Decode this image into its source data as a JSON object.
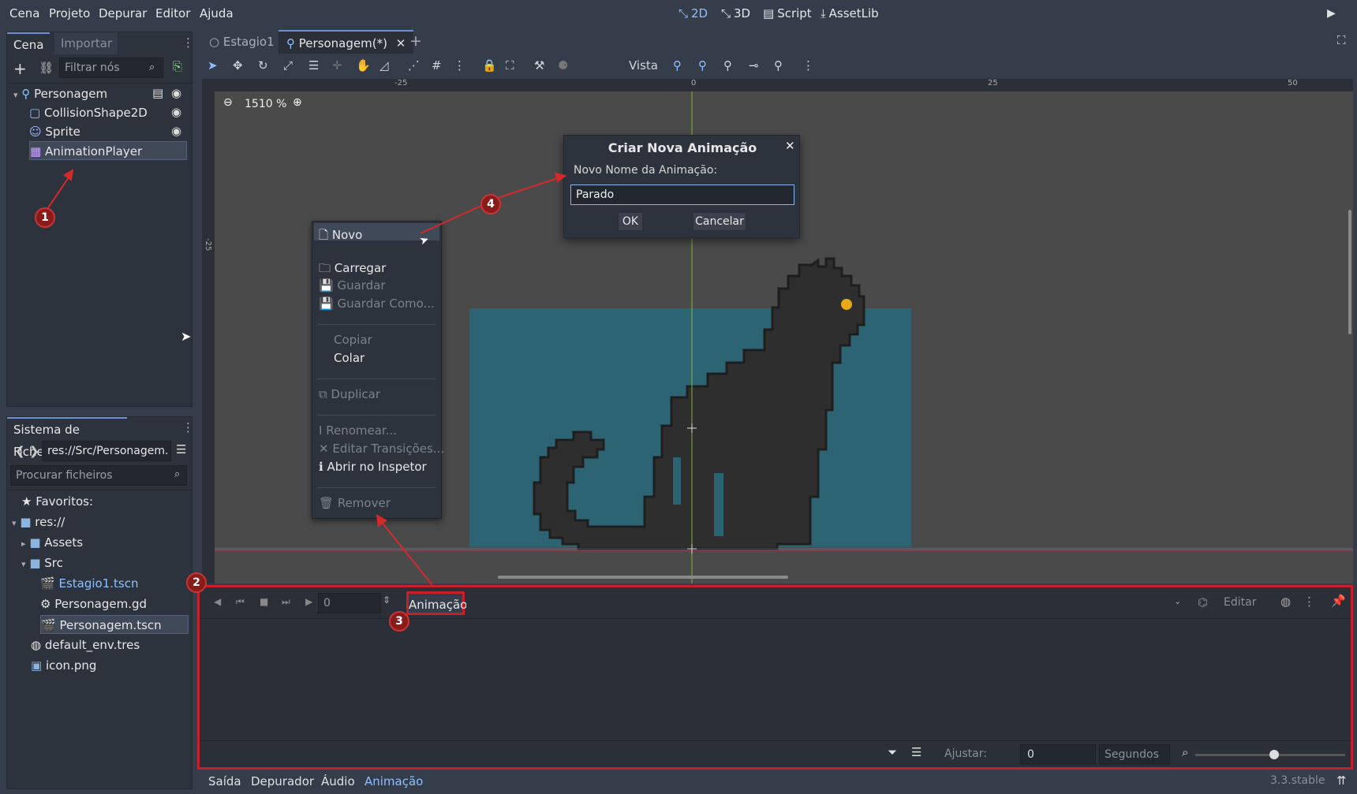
{
  "menubar": {
    "items": [
      "Cena",
      "Projeto",
      "Depurar",
      "Editor",
      "Ajuda"
    ],
    "workspaces": [
      "2D",
      "3D",
      "Script",
      "AssetLib"
    ],
    "active_workspace": "2D"
  },
  "scene_dock": {
    "tabs": [
      "Cena",
      "Importar"
    ],
    "filter_placeholder": "Filtrar nós",
    "nodes": [
      {
        "label": "Personagem",
        "icon": "kinematic-body-icon",
        "level": 0
      },
      {
        "label": "CollisionShape2D",
        "icon": "collision-shape-icon",
        "level": 1
      },
      {
        "label": "Sprite",
        "icon": "sprite-icon",
        "level": 1
      },
      {
        "label": "AnimationPlayer",
        "icon": "animation-player-icon",
        "level": 1,
        "selected": true
      }
    ]
  },
  "file_dock": {
    "title": "Sistema de Ficheiros",
    "path": "res://Src/Personagem.",
    "search_placeholder": "Procurar ficheiros",
    "items": [
      {
        "label": "Favoritos:",
        "icon": "star-icon",
        "level": 0
      },
      {
        "label": "res://",
        "icon": "folder-icon",
        "level": 0
      },
      {
        "label": "Assets",
        "icon": "folder-icon",
        "level": 1
      },
      {
        "label": "Src",
        "icon": "folder-icon",
        "level": 1
      },
      {
        "label": "Estagio1.tscn",
        "icon": "scene-icon",
        "level": 2,
        "color": "#8cc0ff"
      },
      {
        "label": "Personagem.gd",
        "icon": "gear-icon",
        "level": 2
      },
      {
        "label": "Personagem.tscn",
        "icon": "scene-icon",
        "level": 2,
        "selected": true
      },
      {
        "label": "default_env.tres",
        "icon": "globe-icon",
        "level": 1
      },
      {
        "label": "icon.png",
        "icon": "image-icon",
        "level": 1
      }
    ]
  },
  "editor_tabs": [
    {
      "label": "Estagio1",
      "active": false
    },
    {
      "label": "Personagem(*)",
      "active": true
    }
  ],
  "toolbar": {
    "view_label": "Vista"
  },
  "viewport": {
    "zoom": "1510 %",
    "ruler_top": [
      "-25",
      "0",
      "25",
      "50"
    ],
    "ruler_left": [
      "-25"
    ]
  },
  "context_menu": {
    "items": [
      {
        "label": "Novo",
        "enabled": true,
        "icon": "new-file-icon"
      },
      {
        "label": "Carregar",
        "enabled": true,
        "icon": "folder-open-icon"
      },
      {
        "label": "Guardar",
        "enabled": false,
        "icon": "save-icon"
      },
      {
        "label": "Guardar Como...",
        "enabled": false,
        "icon": "save-icon"
      },
      {
        "label": "Copiar",
        "enabled": false
      },
      {
        "label": "Colar",
        "enabled": true
      },
      {
        "label": "Duplicar",
        "enabled": false,
        "icon": "duplicate-icon"
      },
      {
        "label": "Renomear...",
        "enabled": false,
        "icon": "rename-icon"
      },
      {
        "label": "Editar Transições...",
        "enabled": false,
        "icon": "blend-icon"
      },
      {
        "label": "Abrir no Inspetor",
        "enabled": true,
        "icon": "info-icon"
      },
      {
        "label": "Remover",
        "enabled": false,
        "icon": "trash-icon"
      }
    ]
  },
  "dialog": {
    "title": "Criar Nova Animação",
    "field_label": "Novo Nome da Animação:",
    "field_value": "Parado",
    "ok": "OK",
    "cancel": "Cancelar"
  },
  "anim_panel": {
    "time_value": "0",
    "animation_button": "Animação",
    "edit_label": "Editar",
    "snap_label": "Ajustar:",
    "snap_value": "0",
    "unit": "Segundos"
  },
  "bottom_tabs": [
    "Saída",
    "Depurador",
    "Áudio",
    "Animação"
  ],
  "active_bottom_tab": "Animação",
  "version": "3.3.stable",
  "markers": [
    "1",
    "2",
    "3",
    "4"
  ],
  "colors": {
    "accent": "#8cc0ff",
    "marker_red": "#c8202a",
    "panel_bg": "#2d333d",
    "viewport_bg": "#4a4a4a",
    "sprite_bg": "#2c6474"
  }
}
